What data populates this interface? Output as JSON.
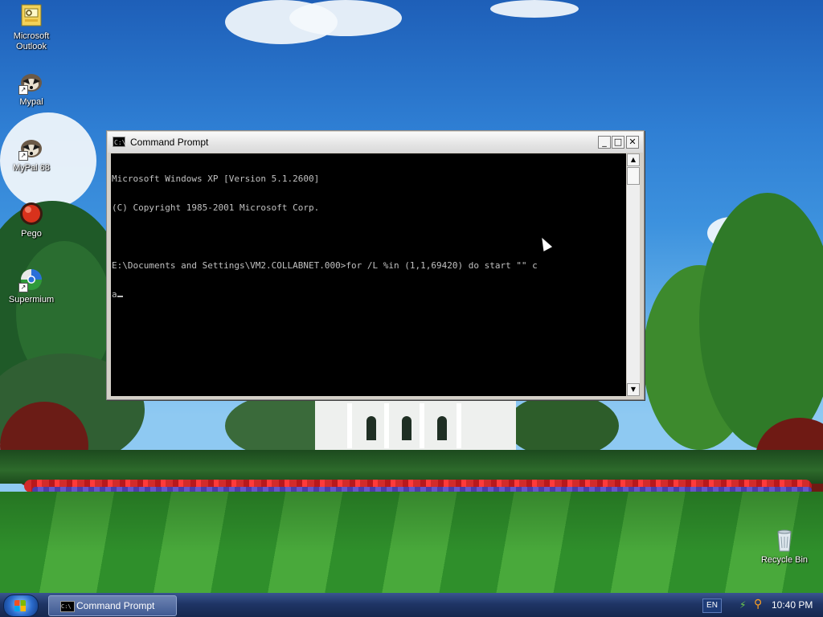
{
  "desktop": {
    "icons": [
      {
        "label": "Microsoft Outlook",
        "icon": "outlook-icon"
      },
      {
        "label": "Mypal",
        "icon": "raccoon-icon"
      },
      {
        "label": "MyPal 68",
        "icon": "raccoon-icon"
      },
      {
        "label": "Pego",
        "icon": "red-orb-icon"
      },
      {
        "label": "Supermium",
        "icon": "supermium-icon"
      },
      {
        "label": "Recycle Bin",
        "icon": "recycle-bin-icon"
      }
    ]
  },
  "window": {
    "title": "Command Prompt",
    "icon_text": "C:\\",
    "buttons": {
      "minimize": "_",
      "maximize": "□",
      "close": "✕"
    },
    "console_lines": [
      "Microsoft Windows XP [Version 5.1.2600]",
      "(C) Copyright 1985-2001 Microsoft Corp.",
      "",
      "E:\\Documents and Settings\\VM2.COLLABNET.000>for /L %in (1,1,69420) do start \"\" c",
      "a"
    ],
    "scroll": {
      "up": "▲",
      "down": "▼"
    }
  },
  "taskbar": {
    "task_label": "Command Prompt",
    "task_icon_text": "C:\\",
    "language": "EN",
    "clock": "10:40 PM"
  }
}
